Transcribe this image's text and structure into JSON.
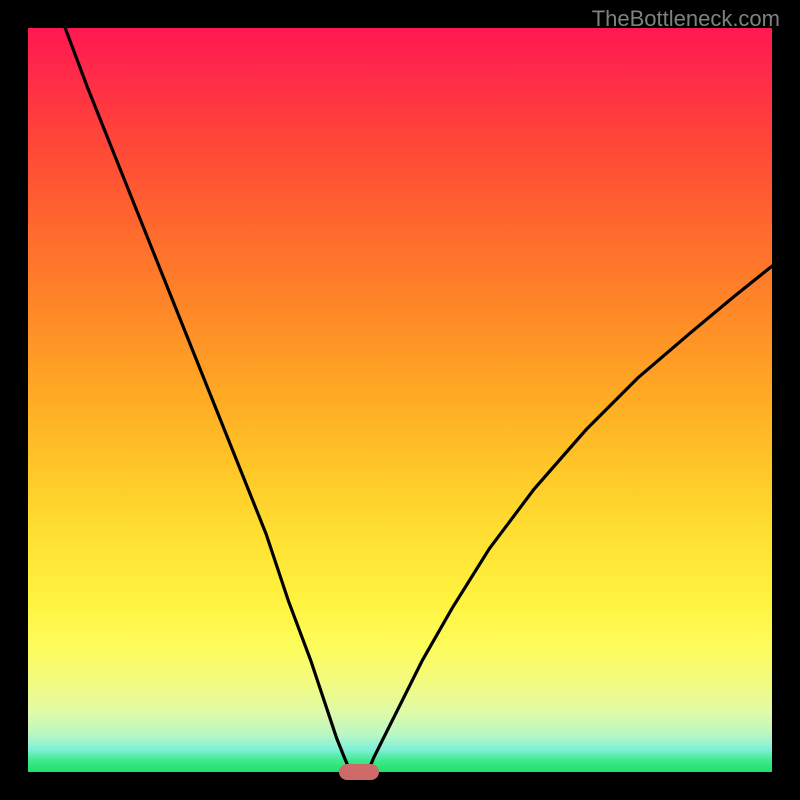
{
  "attribution": "TheBottleneck.com",
  "chart_data": {
    "type": "line",
    "title": "",
    "xlabel": "",
    "ylabel": "",
    "xlim": [
      0,
      100
    ],
    "ylim": [
      0,
      100
    ],
    "background_gradient": {
      "top": "#ff1850",
      "middle": "#ffe233",
      "bottom": "#1de26a"
    },
    "series": [
      {
        "name": "left-branch",
        "x": [
          5,
          8,
          12,
          16,
          20,
          24,
          28,
          32,
          35,
          38,
          40,
          41.5,
          42.5,
          43,
          43.3
        ],
        "y": [
          100,
          92,
          82,
          72,
          62,
          52,
          42,
          32,
          23,
          15,
          9,
          4.5,
          2,
          0.8,
          0.3
        ]
      },
      {
        "name": "right-branch",
        "x": [
          45.7,
          46,
          46.5,
          48,
          50,
          53,
          57,
          62,
          68,
          75,
          82,
          89,
          95,
          100
        ],
        "y": [
          0.3,
          0.8,
          2,
          5,
          9,
          15,
          22,
          30,
          38,
          46,
          53,
          59,
          64,
          68
        ]
      }
    ],
    "marker": {
      "x": 44.5,
      "y": 0.0,
      "color": "#cf6a6a"
    }
  }
}
